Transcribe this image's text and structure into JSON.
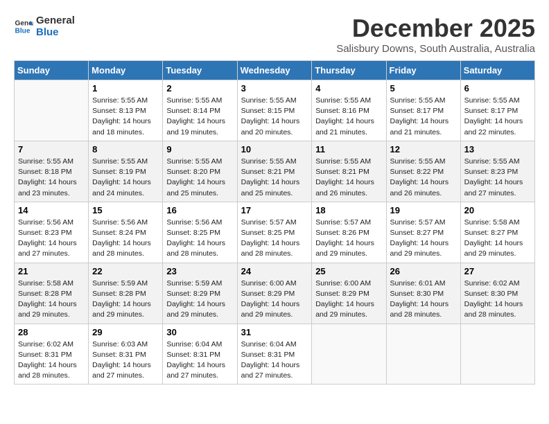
{
  "header": {
    "logo_general": "General",
    "logo_blue": "Blue",
    "title": "December 2025",
    "subtitle": "Salisbury Downs, South Australia, Australia"
  },
  "days_of_week": [
    "Sunday",
    "Monday",
    "Tuesday",
    "Wednesday",
    "Thursday",
    "Friday",
    "Saturday"
  ],
  "weeks": [
    [
      {
        "day": "",
        "info": ""
      },
      {
        "day": "1",
        "info": "Sunrise: 5:55 AM\nSunset: 8:13 PM\nDaylight: 14 hours\nand 18 minutes."
      },
      {
        "day": "2",
        "info": "Sunrise: 5:55 AM\nSunset: 8:14 PM\nDaylight: 14 hours\nand 19 minutes."
      },
      {
        "day": "3",
        "info": "Sunrise: 5:55 AM\nSunset: 8:15 PM\nDaylight: 14 hours\nand 20 minutes."
      },
      {
        "day": "4",
        "info": "Sunrise: 5:55 AM\nSunset: 8:16 PM\nDaylight: 14 hours\nand 21 minutes."
      },
      {
        "day": "5",
        "info": "Sunrise: 5:55 AM\nSunset: 8:17 PM\nDaylight: 14 hours\nand 21 minutes."
      },
      {
        "day": "6",
        "info": "Sunrise: 5:55 AM\nSunset: 8:17 PM\nDaylight: 14 hours\nand 22 minutes."
      }
    ],
    [
      {
        "day": "7",
        "info": "Sunrise: 5:55 AM\nSunset: 8:18 PM\nDaylight: 14 hours\nand 23 minutes."
      },
      {
        "day": "8",
        "info": "Sunrise: 5:55 AM\nSunset: 8:19 PM\nDaylight: 14 hours\nand 24 minutes."
      },
      {
        "day": "9",
        "info": "Sunrise: 5:55 AM\nSunset: 8:20 PM\nDaylight: 14 hours\nand 25 minutes."
      },
      {
        "day": "10",
        "info": "Sunrise: 5:55 AM\nSunset: 8:21 PM\nDaylight: 14 hours\nand 25 minutes."
      },
      {
        "day": "11",
        "info": "Sunrise: 5:55 AM\nSunset: 8:21 PM\nDaylight: 14 hours\nand 26 minutes."
      },
      {
        "day": "12",
        "info": "Sunrise: 5:55 AM\nSunset: 8:22 PM\nDaylight: 14 hours\nand 26 minutes."
      },
      {
        "day": "13",
        "info": "Sunrise: 5:55 AM\nSunset: 8:23 PM\nDaylight: 14 hours\nand 27 minutes."
      }
    ],
    [
      {
        "day": "14",
        "info": "Sunrise: 5:56 AM\nSunset: 8:23 PM\nDaylight: 14 hours\nand 27 minutes."
      },
      {
        "day": "15",
        "info": "Sunrise: 5:56 AM\nSunset: 8:24 PM\nDaylight: 14 hours\nand 28 minutes."
      },
      {
        "day": "16",
        "info": "Sunrise: 5:56 AM\nSunset: 8:25 PM\nDaylight: 14 hours\nand 28 minutes."
      },
      {
        "day": "17",
        "info": "Sunrise: 5:57 AM\nSunset: 8:25 PM\nDaylight: 14 hours\nand 28 minutes."
      },
      {
        "day": "18",
        "info": "Sunrise: 5:57 AM\nSunset: 8:26 PM\nDaylight: 14 hours\nand 29 minutes."
      },
      {
        "day": "19",
        "info": "Sunrise: 5:57 AM\nSunset: 8:27 PM\nDaylight: 14 hours\nand 29 minutes."
      },
      {
        "day": "20",
        "info": "Sunrise: 5:58 AM\nSunset: 8:27 PM\nDaylight: 14 hours\nand 29 minutes."
      }
    ],
    [
      {
        "day": "21",
        "info": "Sunrise: 5:58 AM\nSunset: 8:28 PM\nDaylight: 14 hours\nand 29 minutes."
      },
      {
        "day": "22",
        "info": "Sunrise: 5:59 AM\nSunset: 8:28 PM\nDaylight: 14 hours\nand 29 minutes."
      },
      {
        "day": "23",
        "info": "Sunrise: 5:59 AM\nSunset: 8:29 PM\nDaylight: 14 hours\nand 29 minutes."
      },
      {
        "day": "24",
        "info": "Sunrise: 6:00 AM\nSunset: 8:29 PM\nDaylight: 14 hours\nand 29 minutes."
      },
      {
        "day": "25",
        "info": "Sunrise: 6:00 AM\nSunset: 8:29 PM\nDaylight: 14 hours\nand 29 minutes."
      },
      {
        "day": "26",
        "info": "Sunrise: 6:01 AM\nSunset: 8:30 PM\nDaylight: 14 hours\nand 28 minutes."
      },
      {
        "day": "27",
        "info": "Sunrise: 6:02 AM\nSunset: 8:30 PM\nDaylight: 14 hours\nand 28 minutes."
      }
    ],
    [
      {
        "day": "28",
        "info": "Sunrise: 6:02 AM\nSunset: 8:31 PM\nDaylight: 14 hours\nand 28 minutes."
      },
      {
        "day": "29",
        "info": "Sunrise: 6:03 AM\nSunset: 8:31 PM\nDaylight: 14 hours\nand 27 minutes."
      },
      {
        "day": "30",
        "info": "Sunrise: 6:04 AM\nSunset: 8:31 PM\nDaylight: 14 hours\nand 27 minutes."
      },
      {
        "day": "31",
        "info": "Sunrise: 6:04 AM\nSunset: 8:31 PM\nDaylight: 14 hours\nand 27 minutes."
      },
      {
        "day": "",
        "info": ""
      },
      {
        "day": "",
        "info": ""
      },
      {
        "day": "",
        "info": ""
      }
    ]
  ]
}
